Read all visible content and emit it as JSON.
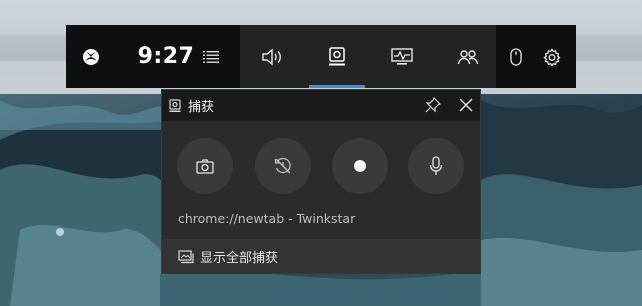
{
  "gamebar": {
    "time": "9:27",
    "colors": {
      "accent": "#3b93e0",
      "bar_dark": "#0f0f0f",
      "bar_mid": "#232323"
    },
    "buttons": [
      "xbox-logo-icon",
      "menu-icon",
      "audio-icon",
      "capture-icon",
      "performance-icon",
      "social-icon",
      "mouse-icon",
      "settings-icon"
    ],
    "active_tab": "capture"
  },
  "capture_widget": {
    "title": "捕获",
    "controls": [
      "screenshot",
      "record-last-30s",
      "start-recording",
      "mic-toggle"
    ],
    "source_caption": "chrome://newtab - Twinkstar",
    "footer_label": "显示全部捕获"
  }
}
